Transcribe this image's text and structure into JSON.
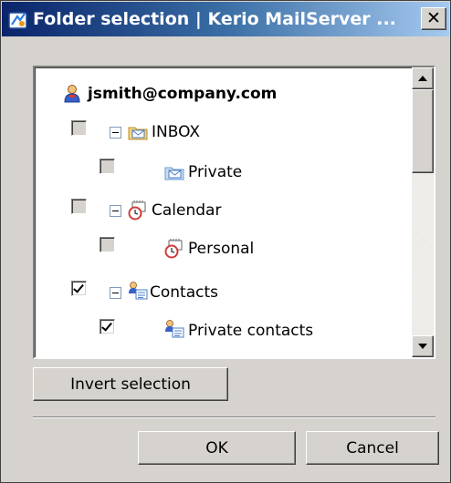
{
  "window": {
    "title": "Folder selection | Kerio MailServer ...",
    "close_symbol": "✕"
  },
  "tree": {
    "account": {
      "label": "jsmith@company.com",
      "icon": "user-icon"
    },
    "items": [
      {
        "label": "INBOX",
        "icon": "mail-folder-icon",
        "checked": false,
        "level": 1,
        "expanded": true
      },
      {
        "label": "Private",
        "icon": "mail-folder-icon",
        "checked": false,
        "level": 2
      },
      {
        "label": "Calendar",
        "icon": "calendar-icon",
        "checked": false,
        "level": 1,
        "expanded": true
      },
      {
        "label": "Personal",
        "icon": "calendar-icon",
        "checked": false,
        "level": 2
      },
      {
        "label": "Contacts",
        "icon": "contacts-icon",
        "checked": true,
        "level": 1,
        "expanded": true
      },
      {
        "label": "Private contacts",
        "icon": "contacts-icon",
        "checked": true,
        "level": 2
      }
    ]
  },
  "buttons": {
    "invert": "Invert selection",
    "ok": "OK",
    "cancel": "Cancel"
  },
  "colors": {
    "titlebar_start": "#0a246a",
    "titlebar_end": "#a6caf0",
    "dialog_bg": "#d6d3ce"
  }
}
